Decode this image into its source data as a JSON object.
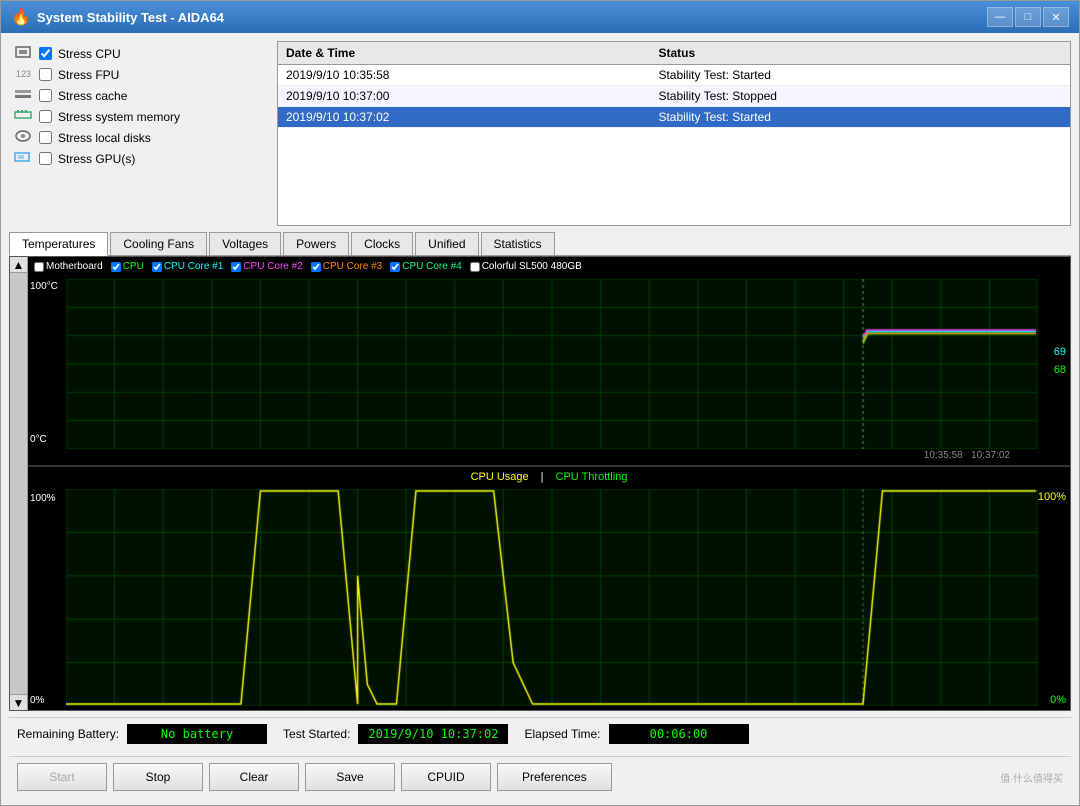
{
  "window": {
    "title": "System Stability Test - AIDA64",
    "icon": "🔥"
  },
  "titlebar": {
    "minimize": "—",
    "maximize": "□",
    "close": "✕"
  },
  "checkboxes": [
    {
      "id": "stress-cpu",
      "label": "Stress CPU",
      "checked": true,
      "icon": "cpu"
    },
    {
      "id": "stress-fpu",
      "label": "Stress FPU",
      "checked": false,
      "icon": "fpu"
    },
    {
      "id": "stress-cache",
      "label": "Stress cache",
      "checked": false,
      "icon": "cache"
    },
    {
      "id": "stress-memory",
      "label": "Stress system memory",
      "checked": false,
      "icon": "memory"
    },
    {
      "id": "stress-disks",
      "label": "Stress local disks",
      "checked": false,
      "icon": "disk"
    },
    {
      "id": "stress-gpu",
      "label": "Stress GPU(s)",
      "checked": false,
      "icon": "gpu"
    }
  ],
  "log": {
    "headers": [
      "Date & Time",
      "Status"
    ],
    "rows": [
      {
        "datetime": "2019/9/10 10:35:58",
        "status": "Stability Test: Started",
        "selected": false
      },
      {
        "datetime": "2019/9/10 10:37:00",
        "status": "Stability Test: Stopped",
        "selected": false
      },
      {
        "datetime": "2019/9/10 10:37:02",
        "status": "Stability Test: Started",
        "selected": true
      }
    ]
  },
  "tabs": [
    {
      "id": "temperatures",
      "label": "Temperatures",
      "active": true
    },
    {
      "id": "cooling-fans",
      "label": "Cooling Fans",
      "active": false
    },
    {
      "id": "voltages",
      "label": "Voltages",
      "active": false
    },
    {
      "id": "powers",
      "label": "Powers",
      "active": false
    },
    {
      "id": "clocks",
      "label": "Clocks",
      "active": false
    },
    {
      "id": "unified",
      "label": "Unified",
      "active": false
    },
    {
      "id": "statistics",
      "label": "Statistics",
      "active": false
    }
  ],
  "temp_chart": {
    "y_max": "100°C",
    "y_min": "0°C",
    "time_label": "10:35:58  10:37:02",
    "legend": [
      {
        "label": "Motherboard",
        "color": "#ffffff",
        "checked": false
      },
      {
        "label": "CPU",
        "color": "#00ff00",
        "checked": true
      },
      {
        "label": "CPU Core #1",
        "color": "#00ffff",
        "checked": true
      },
      {
        "label": "CPU Core #2",
        "color": "#ff00ff",
        "checked": true
      },
      {
        "label": "CPU Core #3",
        "color": "#ff8800",
        "checked": true
      },
      {
        "label": "CPU Core #4",
        "color": "#00ff88",
        "checked": true
      },
      {
        "label": "Colorful SL500 480GB",
        "color": "#ffffff",
        "checked": false
      }
    ],
    "values": [
      "69",
      "68"
    ]
  },
  "cpu_chart": {
    "y_max": "100%",
    "y_min": "0%",
    "value_right_top": "100%",
    "value_right_bottom": "0%",
    "legend": [
      {
        "label": "CPU Usage",
        "color": "#ffff00"
      },
      {
        "label": "CPU Throttling",
        "color": "#00ff00"
      }
    ]
  },
  "status_bar": {
    "battery_label": "Remaining Battery:",
    "battery_value": "No battery",
    "started_label": "Test Started:",
    "started_value": "2019/9/10 10:37:02",
    "elapsed_label": "Elapsed Time:",
    "elapsed_value": "00:06:00"
  },
  "buttons": {
    "start": "Start",
    "stop": "Stop",
    "clear": "Clear",
    "save": "Save",
    "cpuid": "CPUID",
    "preferences": "Preferences"
  }
}
